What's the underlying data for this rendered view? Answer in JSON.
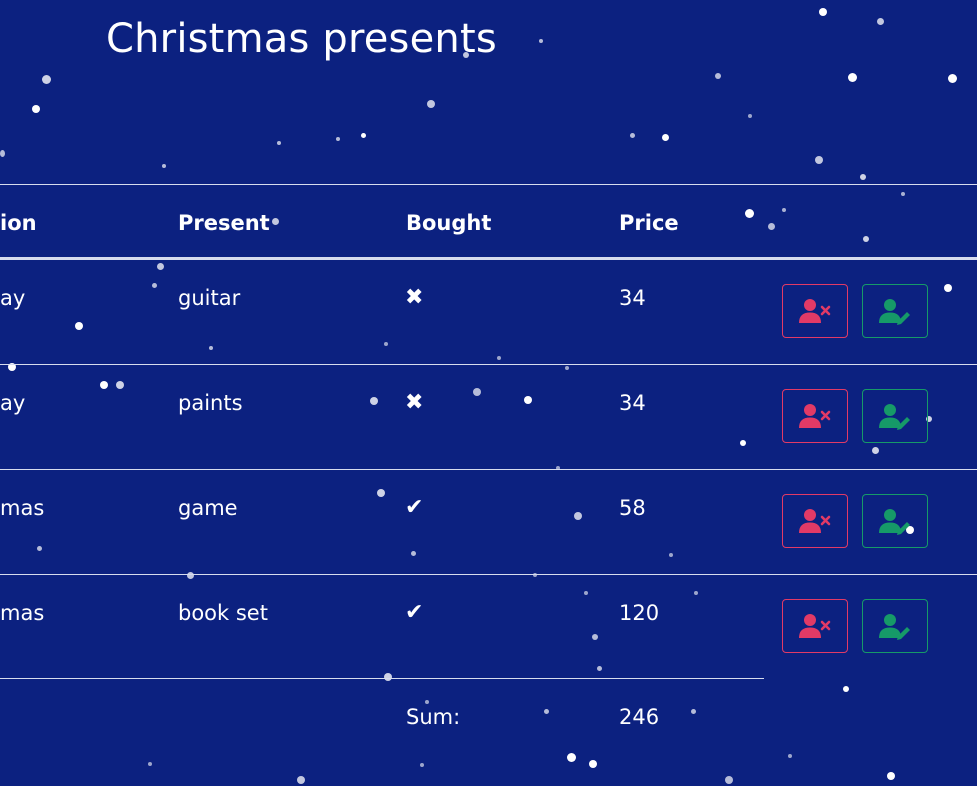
{
  "page": {
    "title": "Christmas presents"
  },
  "table": {
    "headers": {
      "occasion": "ion",
      "present": "Present",
      "bought": "Bought",
      "price": "Price"
    },
    "rows": [
      {
        "occasion": "ay",
        "present": "guitar",
        "bought": "✖",
        "bought_icon": "x-icon",
        "price": "34",
        "delete_icon": "remove-user-icon",
        "edit_icon": "edit-user-icon"
      },
      {
        "occasion": "ay",
        "present": "paints",
        "bought": "✖",
        "bought_icon": "x-icon",
        "price": "34",
        "delete_icon": "remove-user-icon",
        "edit_icon": "edit-user-icon"
      },
      {
        "occasion": "mas",
        "present": "game",
        "bought": "✔",
        "bought_icon": "checkmark-icon",
        "price": "58",
        "delete_icon": "remove-user-icon",
        "edit_icon": "edit-user-icon"
      },
      {
        "occasion": "mas",
        "present": "book set",
        "bought": "✔",
        "bought_icon": "checkmark-icon",
        "price": "120",
        "delete_icon": "remove-user-icon",
        "edit_icon": "edit-user-icon"
      }
    ],
    "footer": {
      "label": "Sum:",
      "value": "246"
    }
  },
  "colors": {
    "background": "#0c2180",
    "delete_accent": "#e23a66",
    "edit_accent": "#169a68",
    "text": "#ffffff"
  }
}
